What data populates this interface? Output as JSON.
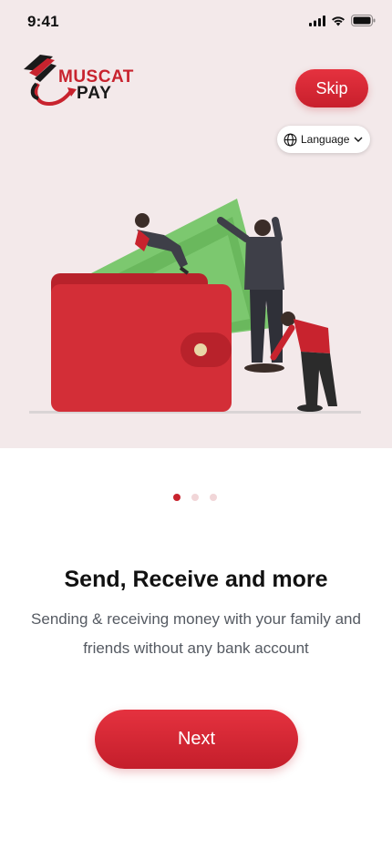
{
  "status_bar": {
    "time": "9:41"
  },
  "logo": {
    "line1": "MUSCAT",
    "line2": "PAY"
  },
  "header": {
    "skip_label": "Skip",
    "language_label": "Language"
  },
  "onboarding": {
    "page_count": 3,
    "current_page": 1,
    "title": "Send, Receive and more",
    "subtitle": "Sending & receiving money with your family and friends without any bank account",
    "next_label": "Next"
  },
  "colors": {
    "accent": "#c8232e",
    "hero_bg": "#f3e9ea",
    "wallet": "#d32e37",
    "money": "#7cc86f"
  },
  "icons": [
    "signal-icon",
    "wifi-icon",
    "battery-icon",
    "globe-icon",
    "chevron-down-icon"
  ]
}
